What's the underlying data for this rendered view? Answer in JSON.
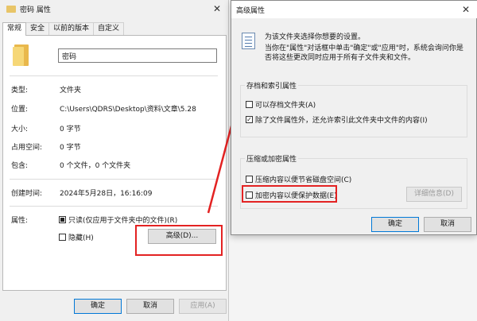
{
  "props_window": {
    "title": "密码 属性",
    "tabs": [
      "常规",
      "安全",
      "以前的版本",
      "自定义"
    ],
    "folder_name": "密码",
    "rows": [
      {
        "label": "类型:",
        "value": "文件夹"
      },
      {
        "label": "位置:",
        "value": "C:\\Users\\QDRS\\Desktop\\资料\\文章\\5.28"
      },
      {
        "label": "大小:",
        "value": "0 字节"
      },
      {
        "label": "占用空间:",
        "value": "0 字节"
      },
      {
        "label": "包含:",
        "value": "0 个文件，0 个文件夹"
      },
      {
        "label": "创建时间:",
        "value": "2024年5月28日，16:16:09"
      }
    ],
    "attributes_label": "属性:",
    "readonly_label": "只读(仅应用于文件夹中的文件)(R)",
    "hidden_label": "隐藏(H)",
    "advanced_button": "高级(D)...",
    "ok_button": "确定",
    "cancel_button": "取消",
    "apply_button": "应用(A)"
  },
  "advanced_dialog": {
    "title": "高级属性",
    "intro_line1": "为该文件夹选择你想要的设置。",
    "intro_line2": "当你在\"属性\"对话框中单击\"确定\"或\"应用\"时，系统会询问你是否将这些更改同时应用于所有子文件夹和文件。",
    "archive_group_title": "存档和索引属性",
    "archive_checkbox": "可以存档文件夹(A)",
    "index_checkbox": "除了文件属性外，还允许索引此文件夹中文件的内容(I)",
    "compress_group_title": "压缩或加密属性",
    "compress_checkbox": "压缩内容以便节省磁盘空间(C)",
    "encrypt_checkbox": "加密内容以便保护数据(E)",
    "details_button": "详细信息(D)",
    "ok_button": "确定",
    "cancel_button": "取消"
  },
  "colors": {
    "highlight_red": "#e32222",
    "folder_yellow": "#f6d777",
    "primary_border": "#0078d7"
  }
}
